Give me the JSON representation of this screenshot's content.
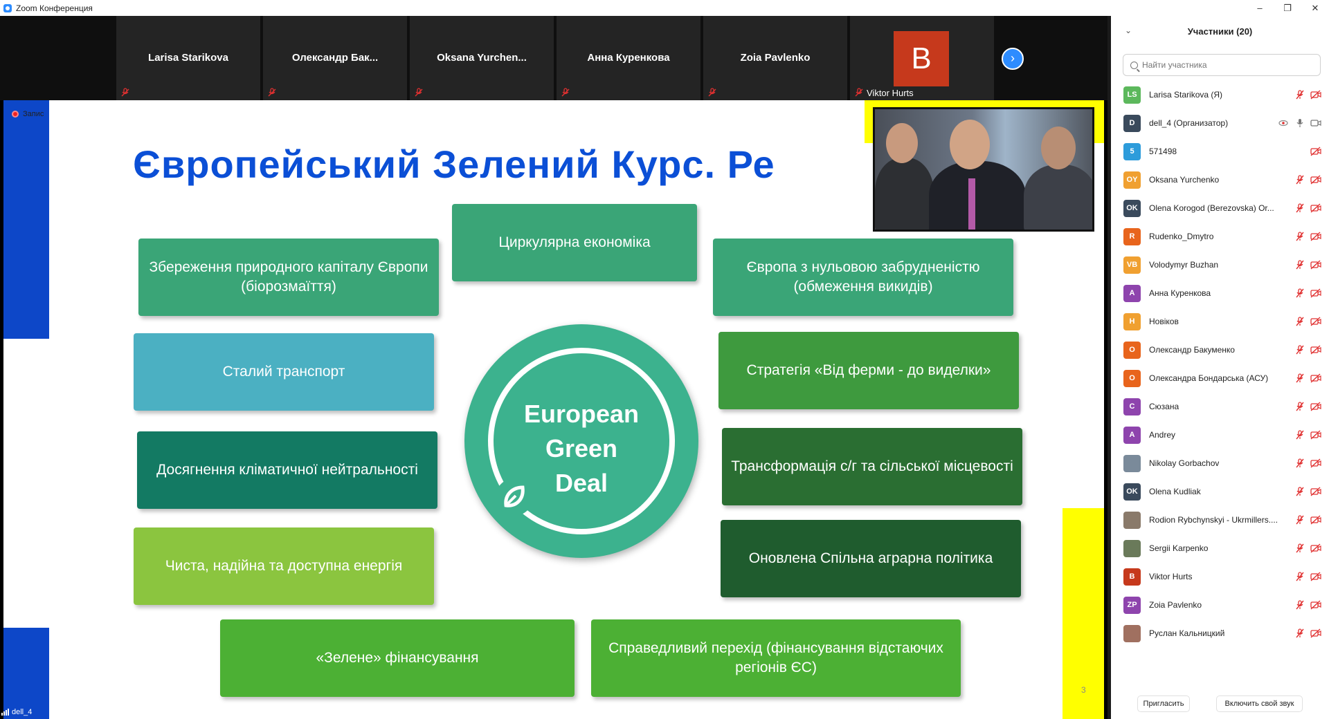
{
  "window": {
    "title": "Zoom Конференция"
  },
  "video_strip": {
    "tiles": [
      {
        "name": "Larisa Starikova"
      },
      {
        "name": "Олександр  Бак..."
      },
      {
        "name": "Oksana  Yurchen..."
      },
      {
        "name": "Анна Куренкова"
      },
      {
        "name": "Zoia Pavlenko"
      }
    ],
    "avatar_tile": {
      "letter": "B",
      "name": "Viktor Hurts"
    }
  },
  "share": {
    "recording_label": "Запис",
    "title": "Європейський Зелений Курс. Ре",
    "boxes": {
      "circular": "Циркулярна  економіка",
      "nature": "Збереження природного капіталу Європи (біорозмаїття)",
      "zero_pollution": "Європа з нульовою забрудненістю (обмеження викидів)",
      "transport": "Сталий транспорт",
      "farm_to_fork": "Стратегія «Від ферми  - до виделки»",
      "climate": "Досягнення кліматичної нейтральності",
      "transformation": "Трансформація с/г та сільської місцевості",
      "energy": "Чиста, надійна та доступна енергія",
      "cap": "Оновлена Спільна аграрна політика",
      "finance": "«Зелене» фінансування",
      "just_transition": "Справедливий перехід (фінансування відстаючих регіонів ЄС)"
    },
    "center": {
      "line1": "European",
      "line2": "Green",
      "line3": "Deal"
    },
    "page_number": "3"
  },
  "presenter": {
    "name": "dell_4"
  },
  "participants": {
    "header": "Участники (20)",
    "search_placeholder": "Найти участника",
    "list": [
      {
        "initials": "LS",
        "name": "Larisa Starikova (Я)",
        "color": "#5cb85c"
      },
      {
        "initials": "D",
        "name": "dell_4 (Организатор)",
        "color": "#3a4a5c"
      },
      {
        "initials": "5",
        "name": "571498",
        "color": "#2d9cdb"
      },
      {
        "initials": "OY",
        "name": "Oksana Yurchenko",
        "color": "#f0a030"
      },
      {
        "initials": "OK",
        "name": "Olena Korogod (Berezovska) Or...",
        "color": "#3a4a5c"
      },
      {
        "initials": "R",
        "name": "Rudenko_Dmytro",
        "color": "#e8641c"
      },
      {
        "initials": "VB",
        "name": "Volodymyr Buzhan",
        "color": "#f0a030"
      },
      {
        "initials": "A",
        "name": "Анна Куренкова",
        "color": "#8e44ad"
      },
      {
        "initials": "H",
        "name": "Новіков",
        "color": "#f0a030"
      },
      {
        "initials": "O",
        "name": "Олександр Бакуменко",
        "color": "#e8641c"
      },
      {
        "initials": "O",
        "name": "Олександра Бондарська (АСУ)",
        "color": "#e8641c"
      },
      {
        "initials": "C",
        "name": "Сюзана",
        "color": "#8e44ad"
      },
      {
        "initials": "A",
        "name": "Andrey",
        "color": "#8e44ad"
      },
      {
        "initials": "",
        "name": "Nikolay Gorbachov",
        "color": "#7a8a9a"
      },
      {
        "initials": "OK",
        "name": "Olena Kudliak",
        "color": "#3a4a5c"
      },
      {
        "initials": "",
        "name": "Rodion Rybchynskyi - Ukrmillers....",
        "color": "#8a7a6a"
      },
      {
        "initials": "",
        "name": "Sergii Karpenko",
        "color": "#6a7a5a"
      },
      {
        "initials": "B",
        "name": "Viktor Hurts",
        "color": "#c6391c"
      },
      {
        "initials": "ZP",
        "name": "Zoia Pavlenko",
        "color": "#8e44ad"
      },
      {
        "initials": "",
        "name": "Руслан Кальницкий",
        "color": "#a07060"
      }
    ],
    "invite_label": "Пригласить",
    "unmute_label": "Включить свой звук"
  }
}
